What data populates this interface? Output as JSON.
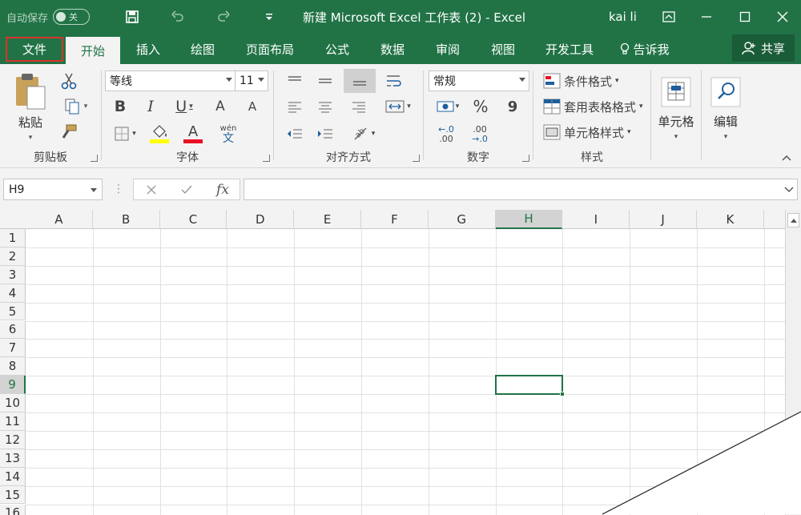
{
  "titlebar": {
    "autosave_label": "自动保存",
    "autosave_state": "关",
    "doc_title": "新建 Microsoft Excel 工作表 (2)  -  Excel",
    "user": "kai li"
  },
  "tabs": {
    "file": "文件",
    "items": [
      "开始",
      "插入",
      "绘图",
      "页面布局",
      "公式",
      "数据",
      "审阅",
      "视图",
      "开发工具",
      "告诉我"
    ],
    "share": "共享"
  },
  "ribbon": {
    "clipboard": {
      "label": "剪贴板",
      "paste": "粘贴"
    },
    "font": {
      "label": "字体",
      "name": "等线",
      "size": "11",
      "bold": "B",
      "italic": "I",
      "underline": "U",
      "grow": "A",
      "shrink": "A",
      "phonetic": "wén",
      "phonetic_char": "文"
    },
    "alignment": {
      "label": "对齐方式"
    },
    "number": {
      "label": "数字",
      "format": "常规",
      "percent": "%",
      "comma": "9",
      "inc_decimal": ".00",
      "dec_decimal": ".00"
    },
    "styles": {
      "label": "样式",
      "conditional": "条件格式",
      "table": "套用表格格式",
      "cell_styles": "单元格样式"
    },
    "cells": {
      "label": "单元格"
    },
    "editing": {
      "label": "编辑"
    },
    "highlight_color": "#ffff00",
    "font_color": "#e81123"
  },
  "formula_bar": {
    "name_box": "H9",
    "fx": "fx",
    "value": ""
  },
  "sheet": {
    "columns": [
      "A",
      "B",
      "C",
      "D",
      "E",
      "F",
      "G",
      "H",
      "I",
      "J",
      "K"
    ],
    "rows": [
      "1",
      "2",
      "3",
      "4",
      "5",
      "6",
      "7",
      "8",
      "9",
      "10",
      "11",
      "12",
      "13",
      "14",
      "15",
      "16"
    ],
    "selected_cell": "H9",
    "accent": "#217346"
  }
}
